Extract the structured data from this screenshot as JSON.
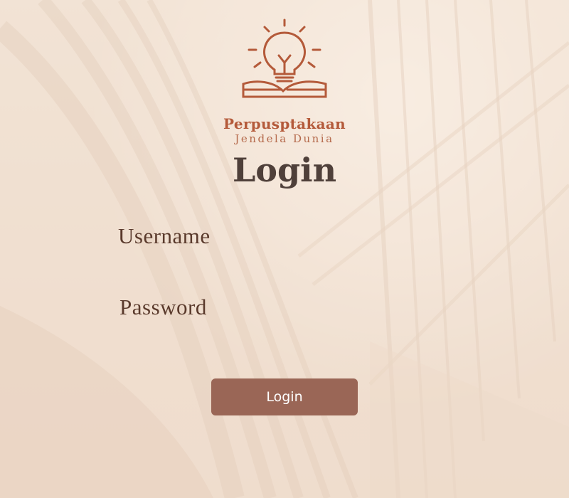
{
  "brand": {
    "name": "Perpusptakaan",
    "tagline": "Jendela Dunia",
    "logo_icon": "lightbulb-book-icon",
    "color": "#b45a3a"
  },
  "page": {
    "title": "Login"
  },
  "form": {
    "username_label": "Username",
    "username_value": "",
    "password_label": "Password",
    "password_value": "",
    "submit_label": "Login"
  },
  "colors": {
    "button": "#9a6656",
    "title": "#4f403a",
    "label": "#5a3a2c",
    "background": "#efe0d2"
  },
  "background_icon": "library-bookshelves-image"
}
